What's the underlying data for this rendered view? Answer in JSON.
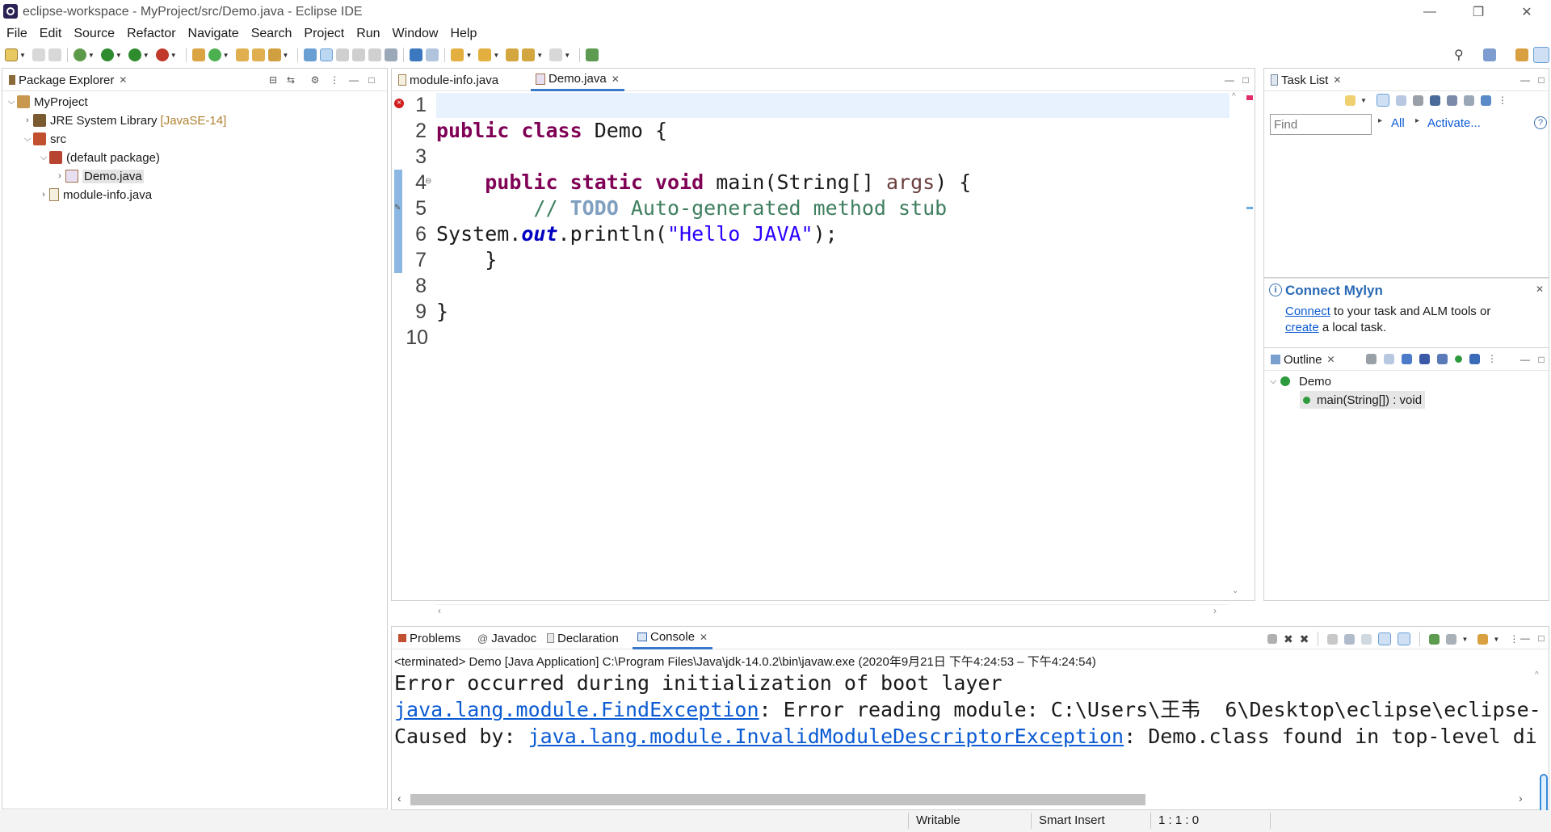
{
  "window": {
    "title": "eclipse-workspace - MyProject/src/Demo.java - Eclipse IDE",
    "minimize": "—",
    "restore": "❐",
    "close": "✕"
  },
  "menu": [
    "File",
    "Edit",
    "Source",
    "Refactor",
    "Navigate",
    "Search",
    "Project",
    "Run",
    "Window",
    "Help"
  ],
  "package_explorer": {
    "tab_label": "Package Explorer",
    "tree": {
      "project": "MyProject",
      "jre": "JRE System Library",
      "jre_version": "[JavaSE-14]",
      "src": "src",
      "package": "(default package)",
      "demo_file": "Demo.java",
      "module_file": "module-info.java"
    }
  },
  "editor": {
    "tabs": [
      "module-info.java",
      "Demo.java"
    ],
    "active_tab": "Demo.java",
    "line_numbers": [
      "1",
      "2",
      "3",
      "4",
      "5",
      "6",
      "7",
      "8",
      "9",
      "10"
    ],
    "code": {
      "l2_kw1": "public",
      "l2_kw2": "class",
      "l2_rest": "Demo {",
      "l4_kw1": "public",
      "l4_kw2": "static",
      "l4_kw3": "void",
      "l4_rest1": "main(String[] ",
      "l4_param": "args",
      "l4_rest2": ") {",
      "l5_comment": "// ",
      "l5_todo": "TODO",
      "l5_rest": " Auto-generated method stub",
      "l6_a": "System.",
      "l6_field": "out",
      "l6_b": ".println(",
      "l6_str": "\"Hello JAVA\"",
      "l6_c": ");",
      "l7": "}",
      "l9": "}"
    }
  },
  "task_list": {
    "tab_label": "Task List",
    "find_placeholder": "Find",
    "all_label": "All",
    "activate_label": "Activate...",
    "help": "?"
  },
  "mylyn": {
    "title": "Connect Mylyn",
    "connect_link": "Connect",
    "text1": " to your task and ALM tools or",
    "create_link": "create",
    "text2": " a local task."
  },
  "outline": {
    "tab_label": "Outline",
    "class_name": "Demo",
    "method": "main(String[]) : void"
  },
  "bottom": {
    "tabs": [
      "Problems",
      "Javadoc",
      "Declaration",
      "Console"
    ],
    "active_tab": "Console",
    "console_header": "<terminated> Demo [Java Application] C:\\Program Files\\Java\\jdk-14.0.2\\bin\\javaw.exe  (2020年9月21日 下午4:24:53 – 下午4:24:54)",
    "lines": {
      "l1": "Error occurred during initialization of boot layer",
      "l2_link": "java.lang.module.FindException",
      "l2_rest": ": Error reading module: C:\\Users\\王韦  6\\Desktop\\eclipse\\eclipse-",
      "l3_prefix": "Caused by: ",
      "l3_link": "java.lang.module.InvalidModuleDescriptorException",
      "l3_rest": ": Demo.class found in top-level di"
    }
  },
  "status": {
    "writable": "Writable",
    "insert_mode": "Smart Insert",
    "position": "1 : 1 : 0"
  },
  "colors": {
    "keyword": "#7f0055",
    "comment": "#3f7f5f",
    "string": "#2a00ff",
    "link": "#0b5bd3",
    "active_tab_accent": "#3a79c9",
    "error": "#d02020"
  }
}
